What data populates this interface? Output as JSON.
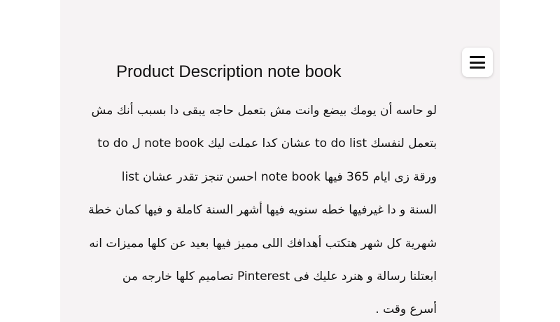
{
  "header": {
    "menu_icon": "hamburger-menu-icon"
  },
  "main": {
    "title": "Product Description note book",
    "description_lines": [
      "لو حاسه أن يومك بيضع وانت مش بتعمل حاجه يبقى دا بسبب أنك مش",
      "بتعمل لنفسك to do list عشان كدا عملت ليك note book ل to do",
      "list  احسن تنجز تقدر عشان note book ورقة زى ايام 365 فيها",
      "السنة و دا غيرفيها خطه سنويه فيها أشهر السنة كاملة و فيها كمان  خطة",
      "شهرية كل شهر  هتكتب أهدافك اللى مميز فيها بعيد عن كلها مميزات انه",
      "ابعتلنا رسالة و  هنرد عليك فى  Pinterest تصاميم كلها خارجه من",
      "أسرع وقت ."
    ]
  }
}
